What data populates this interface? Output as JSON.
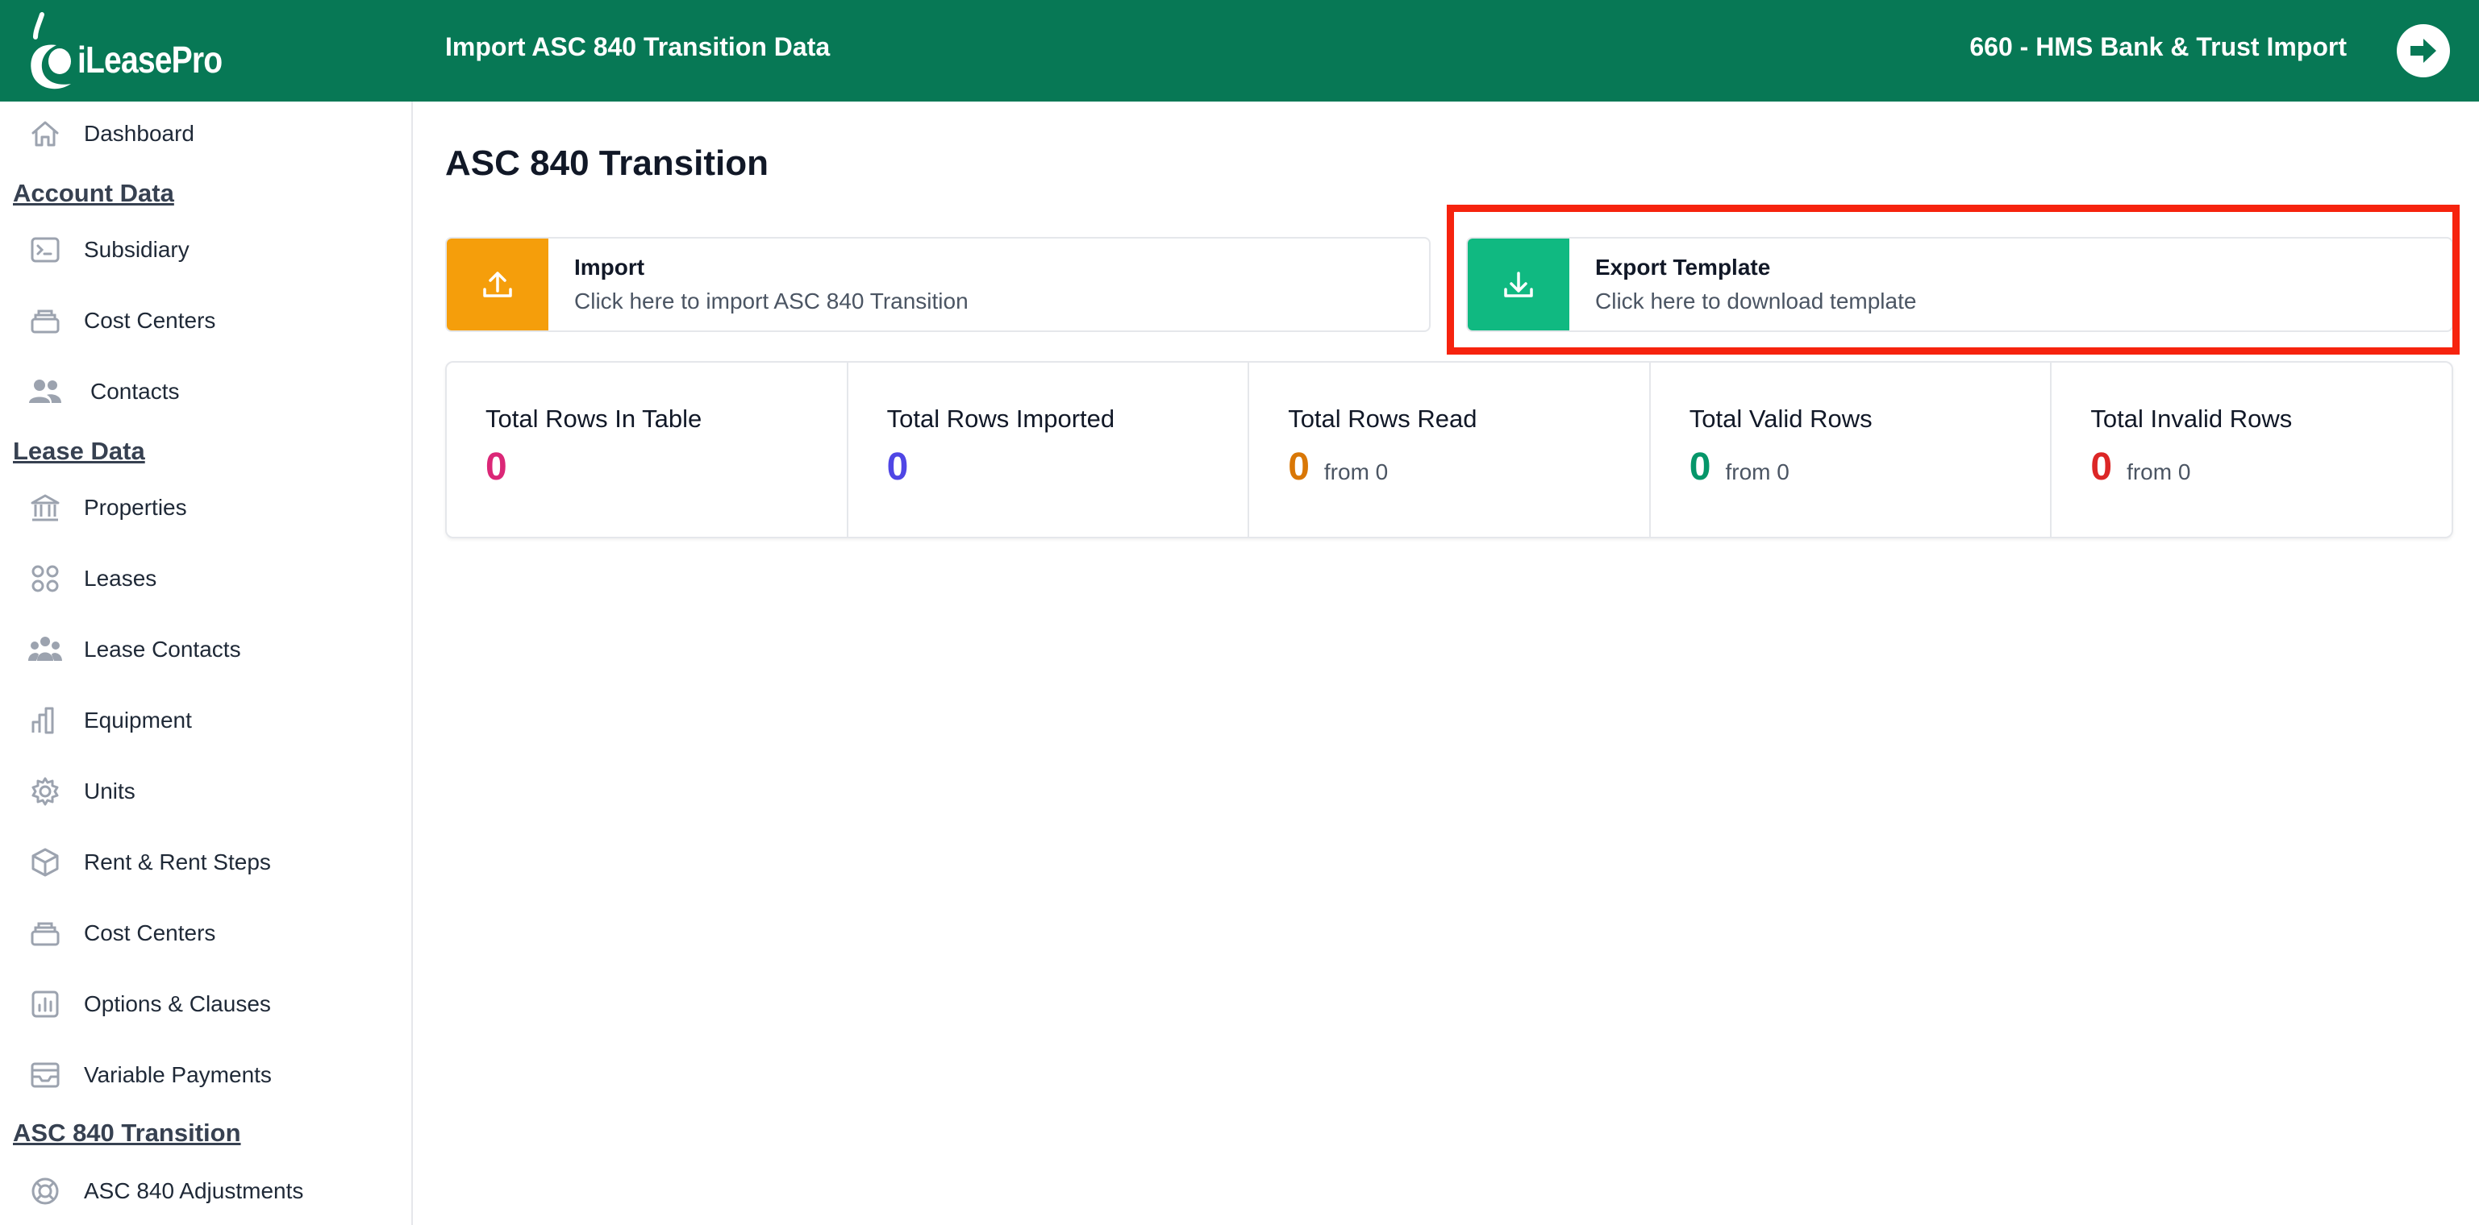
{
  "header": {
    "logo_text": "iLeasePro",
    "page_heading": "Import ASC 840 Transition Data",
    "company": "660 - HMS Bank & Trust Import"
  },
  "sidebar": {
    "items_top": [
      {
        "label": "Dashboard",
        "icon": "home-icon"
      }
    ],
    "sections": [
      {
        "title": "Account Data",
        "items": [
          {
            "label": "Subsidiary",
            "icon": "terminal-icon"
          },
          {
            "label": "Cost Centers",
            "icon": "stack-icon"
          },
          {
            "label": "Contacts",
            "icon": "users-icon"
          }
        ]
      },
      {
        "title": "Lease Data",
        "items": [
          {
            "label": "Properties",
            "icon": "bank-icon"
          },
          {
            "label": "Leases",
            "icon": "grid-icon"
          },
          {
            "label": "Lease Contacts",
            "icon": "user-group-icon"
          },
          {
            "label": "Equipment",
            "icon": "bar-chart-icon"
          },
          {
            "label": "Units",
            "icon": "gear-icon"
          },
          {
            "label": "Rent & Rent Steps",
            "icon": "cube-icon"
          },
          {
            "label": "Cost Centers",
            "icon": "stack-icon"
          },
          {
            "label": "Options & Clauses",
            "icon": "chart-box-icon"
          },
          {
            "label": "Variable Payments",
            "icon": "inbox-icon"
          }
        ]
      },
      {
        "title": "ASC 840 Transition",
        "items": [
          {
            "label": "ASC 840 Adjustments",
            "icon": "lifebuoy-icon"
          }
        ]
      }
    ]
  },
  "main": {
    "title": "ASC 840 Transition",
    "import_card": {
      "title": "Import",
      "subtitle": "Click here to import ASC 840 Transition"
    },
    "export_card": {
      "title": "Export Template",
      "subtitle": "Click here to download template"
    },
    "stats": [
      {
        "label": "Total Rows In Table",
        "value": "0",
        "from": "",
        "color": "#db2777"
      },
      {
        "label": "Total Rows Imported",
        "value": "0",
        "from": "",
        "color": "#4f46e5"
      },
      {
        "label": "Total Rows Read",
        "value": "0",
        "from": "from 0",
        "color": "#d97706"
      },
      {
        "label": "Total Valid Rows",
        "value": "0",
        "from": "from 0",
        "color": "#059669"
      },
      {
        "label": "Total Invalid Rows",
        "value": "0",
        "from": "from 0",
        "color": "#dc2626"
      }
    ]
  },
  "colors": {
    "header_bg": "#077855",
    "import_accent": "#f59e0b",
    "export_accent": "#10b981",
    "highlight": "#f6230e"
  }
}
